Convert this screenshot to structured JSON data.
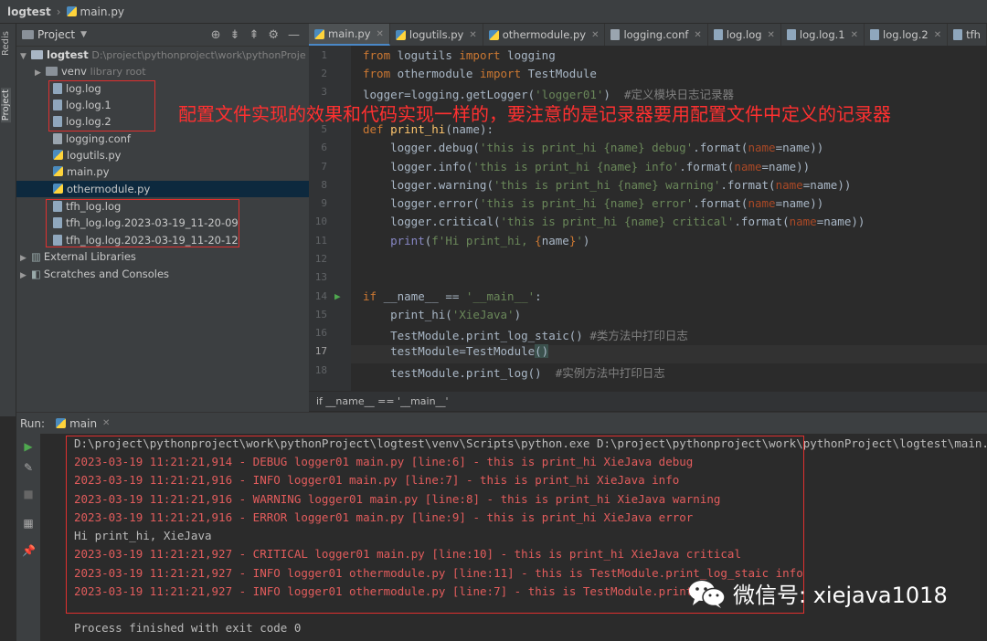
{
  "breadcrumb": {
    "project": "logtest",
    "file": "main.py"
  },
  "sidebar": {
    "redis_label": "Redis",
    "project_label": "Project"
  },
  "project_panel": {
    "title": "Project",
    "root_name": "logtest",
    "root_path": "D:\\project\\pythonproject\\work\\pythonProje",
    "venv": "venv",
    "venv_note": "library root",
    "files": [
      {
        "name": "log.log",
        "icon": "log-file-icon"
      },
      {
        "name": "log.log.1",
        "icon": "log-file-icon"
      },
      {
        "name": "log.log.2",
        "icon": "log-file-icon"
      },
      {
        "name": "logging.conf",
        "icon": "conf-file-icon"
      },
      {
        "name": "logutils.py",
        "icon": "python-file-icon"
      },
      {
        "name": "main.py",
        "icon": "python-file-icon"
      },
      {
        "name": "othermodule.py",
        "icon": "python-file-icon"
      },
      {
        "name": "tfh_log.log",
        "icon": "log-file-icon"
      },
      {
        "name": "tfh_log.log.2023-03-19_11-20-09",
        "icon": "log-file-icon"
      },
      {
        "name": "tfh_log.log.2023-03-19_11-20-12",
        "icon": "log-file-icon"
      }
    ],
    "external_libraries": "External Libraries",
    "scratches": "Scratches and Consoles"
  },
  "editor": {
    "tabs": [
      "main.py",
      "logutils.py",
      "othermodule.py",
      "logging.conf",
      "log.log",
      "log.log.1",
      "log.log.2",
      "tfh"
    ],
    "line_numbers": [
      "1",
      "2",
      "3",
      "",
      "5",
      "6",
      "7",
      "8",
      "9",
      "10",
      "11",
      "12",
      "13",
      "14",
      "15",
      "16",
      "17",
      "18"
    ],
    "code_breadcrumb": "if __name__ == '__main__'"
  },
  "annotation": "配置文件实现的效果和代码实现一样的，要注意的是记录器要用配置文件中定义的记录器",
  "run": {
    "label": "Run:",
    "tab": "main",
    "lines": [
      "D:\\project\\pythonproject\\work\\pythonProject\\logtest\\venv\\Scripts\\python.exe D:\\project\\pythonproject\\work\\pythonProject\\logtest\\main.py",
      "2023-03-19 11:21:21,914 - DEBUG logger01 main.py [line:6] - this is print_hi XieJava debug",
      "2023-03-19 11:21:21,916 - INFO logger01 main.py [line:7] - this is print_hi XieJava info",
      "2023-03-19 11:21:21,916 - WARNING logger01 main.py [line:8] - this is print_hi XieJava warning",
      "2023-03-19 11:21:21,916 - ERROR logger01 main.py [line:9] - this is print_hi XieJava error",
      "Hi print_hi, XieJava",
      "2023-03-19 11:21:21,927 - CRITICAL logger01 main.py [line:10] - this is print_hi XieJava critical",
      "2023-03-19 11:21:21,927 - INFO logger01 othermodule.py [line:11] - this is TestModule.print_log_staic info",
      "2023-03-19 11:21:21,927 - INFO logger01 othermodule.py [line:7] - this is TestModule.print_",
      "",
      "Process finished with exit code 0"
    ]
  },
  "watermark": "微信号: xiejava1018",
  "colors": {
    "accent": "#4a88c7",
    "annotation_red": "#e0302f",
    "log_red": "#e25c5c"
  }
}
